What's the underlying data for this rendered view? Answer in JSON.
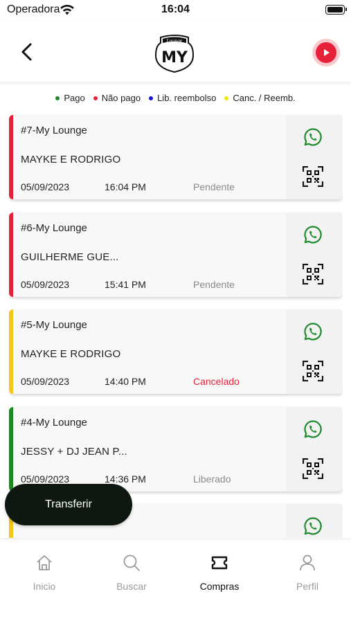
{
  "status_bar": {
    "carrier": "Operadora",
    "time": "16:04"
  },
  "header": {
    "logo_top_text": "Lounge",
    "logo_text": "MY"
  },
  "legend": [
    {
      "label": "Pago",
      "color": "#1a8a1a"
    },
    {
      "label": "Não pago",
      "color": "#e8213a"
    },
    {
      "label": "Lib. reembolso",
      "color": "#1515d6"
    },
    {
      "label": "Canc. / Reemb.",
      "color": "#f2e600"
    }
  ],
  "orders": [
    {
      "title": "#7-My Lounge",
      "name": "MAYKE E RODRIGO",
      "date": "05/09/2023",
      "time": "16:04 PM",
      "status": "Pendente",
      "status_color": "#8a8a8a",
      "bar_color": "#e8213a"
    },
    {
      "title": "#6-My Lounge",
      "name": "GUILHERME GUE...",
      "date": "05/09/2023",
      "time": "15:41 PM",
      "status": "Pendente",
      "status_color": "#8a8a8a",
      "bar_color": "#e8213a"
    },
    {
      "title": "#5-My Lounge",
      "name": "MAYKE E RODRIGO",
      "date": "05/09/2023",
      "time": "14:40 PM",
      "status": "Cancelado",
      "status_color": "#e8213a",
      "bar_color": "#f5c518"
    },
    {
      "title": "#4-My Lounge",
      "name": "JESSY + DJ JEAN P...",
      "date": "05/09/2023",
      "time": "14:36 PM",
      "status": "Liberado",
      "status_color": "#8a8a8a",
      "bar_color": "#1a8a1a"
    },
    {
      "title": "",
      "name": "",
      "date": "",
      "time": "",
      "status": "",
      "status_color": "#8a8a8a",
      "bar_color": "#f5c518"
    }
  ],
  "transfer_button": {
    "label": "Transferir"
  },
  "tabs": [
    {
      "label": "Inicio",
      "icon": "home-icon",
      "active": false
    },
    {
      "label": "Buscar",
      "icon": "search-icon",
      "active": false
    },
    {
      "label": "Compras",
      "icon": "ticket-icon",
      "active": true
    },
    {
      "label": "Perfil",
      "icon": "user-icon",
      "active": false
    }
  ]
}
